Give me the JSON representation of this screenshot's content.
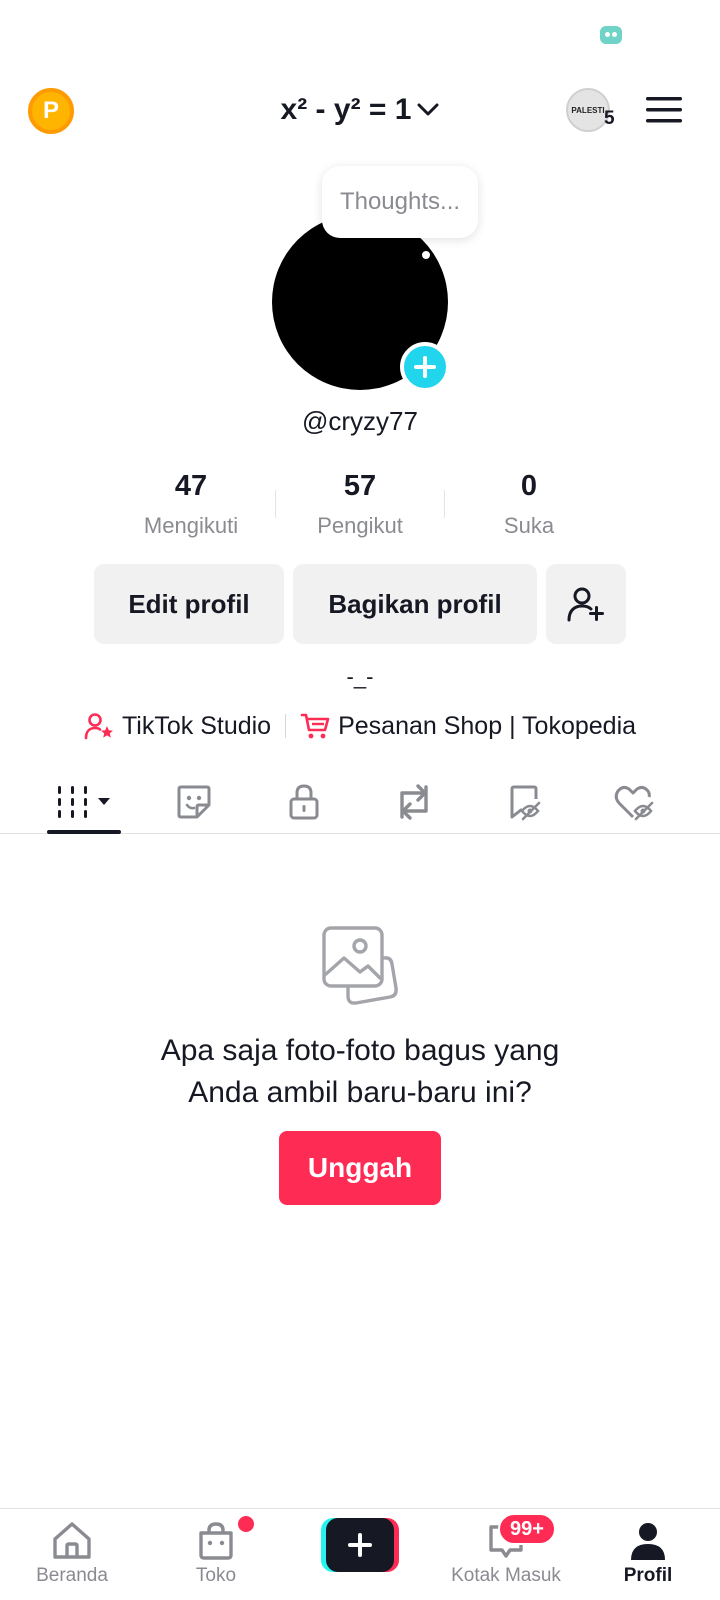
{
  "topbar": {
    "coin_letter": "P",
    "title": "x² - y² = 1",
    "badge_text": "PALESTI",
    "badge_count": "5"
  },
  "profile": {
    "thought_bubble": "Thoughts...",
    "handle": "@cryzy77",
    "bio": "-_-"
  },
  "stats": [
    {
      "value": "47",
      "label": "Mengikuti"
    },
    {
      "value": "57",
      "label": "Pengikut"
    },
    {
      "value": "0",
      "label": "Suka"
    }
  ],
  "buttons": {
    "edit": "Edit profil",
    "share": "Bagikan profil"
  },
  "links": {
    "studio": "TikTok Studio",
    "shop": "Pesanan Shop | Tokopedia"
  },
  "tabs": [
    "videos-grid-icon",
    "stickers-icon",
    "lock-icon",
    "repost-icon",
    "favorites-icon",
    "liked-icon"
  ],
  "empty_state": {
    "line1": "Apa saja foto-foto bagus yang",
    "line2": "Anda ambil baru-baru ini?",
    "button": "Unggah"
  },
  "nav": {
    "home": "Beranda",
    "shop": "Toko",
    "inbox": "Kotak Masuk",
    "inbox_badge": "99+",
    "profile": "Profil"
  },
  "colors": {
    "accent": "#fe2c55",
    "cyan": "#20d5ec",
    "text": "#161823",
    "muted": "#8a8b91"
  }
}
